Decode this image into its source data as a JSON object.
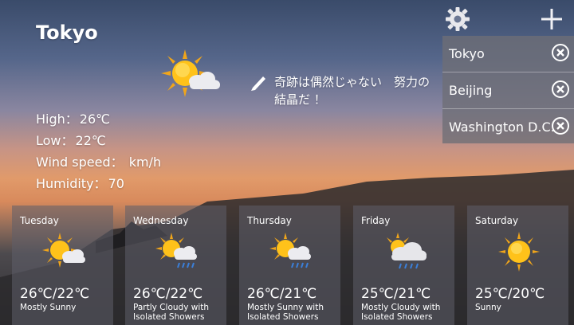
{
  "city": "Tokyo",
  "note": "奇跡は偶然じゃない　努力の結晶だ ！",
  "stats": {
    "high_label": "High：",
    "high_value": "26℃",
    "low_label": "Low：",
    "low_value": "22℃",
    "wind_label": "Wind speed：",
    "wind_value": " km/h",
    "humidity_label": "Humidity：",
    "humidity_value": "70"
  },
  "cities": [
    "Tokyo",
    "Beijing",
    "Washington D.C."
  ],
  "forecast": [
    {
      "day": "Tuesday",
      "temp": "26℃/22℃",
      "desc": "Mostly Sunny",
      "icon": "sun-cloud-icon"
    },
    {
      "day": "Wednesday",
      "temp": "26℃/22℃",
      "desc": "Partly Cloudy with Isolated Showers",
      "icon": "sun-cloud-rain-icon"
    },
    {
      "day": "Thursday",
      "temp": "26℃/21℃",
      "desc": "Mostly Sunny with Isolated Showers",
      "icon": "sun-cloud-rain-icon"
    },
    {
      "day": "Friday",
      "temp": "25℃/21℃",
      "desc": "Mostly Cloudy with Isolated Showers",
      "icon": "cloud-rain-icon"
    },
    {
      "day": "Saturday",
      "temp": "25℃/20℃",
      "desc": "Sunny",
      "icon": "sun-icon"
    }
  ]
}
